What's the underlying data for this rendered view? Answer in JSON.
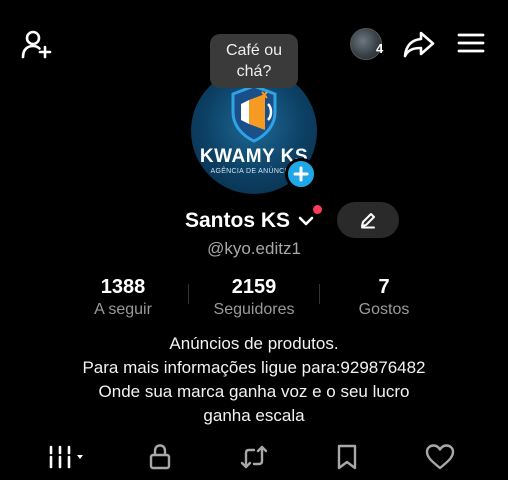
{
  "tooltip": {
    "text": "Café ou\nchá?"
  },
  "header": {
    "friends_count": "4"
  },
  "avatar": {
    "brand": "KWAMY KS",
    "subtitle": "AGÊNCIA DE ANÚNCIOS"
  },
  "profile": {
    "display_name": "Santos KS",
    "username": "@kyo.editz1"
  },
  "stats": [
    {
      "value": "1388",
      "label": "A seguir"
    },
    {
      "value": "2159",
      "label": "Seguidores"
    },
    {
      "value": "7",
      "label": "Gostos"
    }
  ],
  "bio": [
    "Anúncios de produtos.",
    "Para mais informações ligue para:929876482",
    "Onde sua marca ganha voz e o seu lucro",
    "ganha escala"
  ],
  "colors": {
    "background": "#000000",
    "online_dot": "#ff3b5c",
    "add_avatar": "#20a8e6",
    "edit_button": "#2a2a2a"
  },
  "icons": {
    "add_user": "add-user-icon",
    "share": "share-icon",
    "menu": "menu-icon",
    "edit": "pencil-icon",
    "tabs": [
      "grid-icon",
      "lock-icon",
      "repost-icon",
      "bookmark-icon",
      "heart-icon"
    ]
  }
}
